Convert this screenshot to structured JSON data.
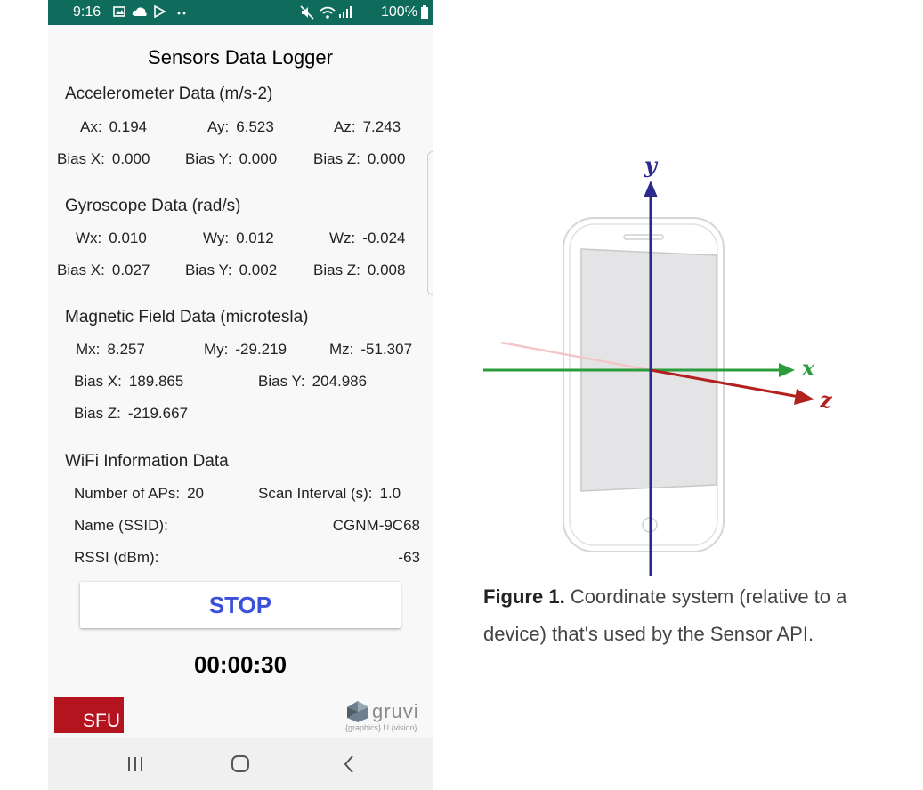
{
  "status_bar": {
    "time": "9:16",
    "battery": "100%"
  },
  "app": {
    "title": "Sensors Data Logger",
    "accelerometer": {
      "heading": "Accelerometer Data (m/s-2)",
      "values": [
        {
          "label": "Ax:",
          "value": "0.194"
        },
        {
          "label": "Ay:",
          "value": "6.523"
        },
        {
          "label": "Az:",
          "value": "7.243"
        }
      ],
      "bias": [
        {
          "label": "Bias X:",
          "value": "0.000"
        },
        {
          "label": "Bias Y:",
          "value": "0.000"
        },
        {
          "label": "Bias Z:",
          "value": "0.000"
        }
      ]
    },
    "gyroscope": {
      "heading": "Gyroscope Data (rad/s)",
      "values": [
        {
          "label": "Wx:",
          "value": "0.010"
        },
        {
          "label": "Wy:",
          "value": "0.012"
        },
        {
          "label": "Wz:",
          "value": "-0.024"
        }
      ],
      "bias": [
        {
          "label": "Bias X:",
          "value": "0.027"
        },
        {
          "label": "Bias Y:",
          "value": "0.002"
        },
        {
          "label": "Bias Z:",
          "value": "0.008"
        }
      ]
    },
    "magnetic": {
      "heading": "Magnetic Field Data (microtesla)",
      "values": [
        {
          "label": "Mx:",
          "value": "8.257"
        },
        {
          "label": "My:",
          "value": "-29.219"
        },
        {
          "label": "Mz:",
          "value": "-51.307"
        }
      ],
      "bias": [
        {
          "label": "Bias X:",
          "value": "189.865"
        },
        {
          "label": "Bias Y:",
          "value": "204.986"
        },
        {
          "label": "Bias Z:",
          "value": "-219.667"
        }
      ]
    },
    "wifi": {
      "heading": "WiFi Information Data",
      "num_aps_label": "Number of APs:",
      "num_aps": "20",
      "scan_interval_label": "Scan Interval (s):",
      "scan_interval": "1.0",
      "ssid_label": "Name (SSID):",
      "ssid": "CGNM-9C68",
      "rssi_label": "RSSI (dBm):",
      "rssi": "-63"
    },
    "stop_label": "STOP",
    "timer": "00:00:30",
    "logo_left": "SFU",
    "logo_right": "gruvi",
    "logo_right_sub": "{graphics} U {vision}"
  },
  "figure": {
    "axis_labels": {
      "x": "x",
      "y": "y",
      "z": "z"
    },
    "caption_bold": "Figure 1.",
    "caption_text": "Coordinate system (relative to a device) that's used by the Sensor API."
  },
  "colors": {
    "status_bar": "#0f6b5c",
    "stop_text": "#3b50d8",
    "sfu_red": "#b3141f",
    "axis_x": "#2a9c3a",
    "axis_y": "#2a2a8c",
    "axis_z": "#b32020"
  }
}
